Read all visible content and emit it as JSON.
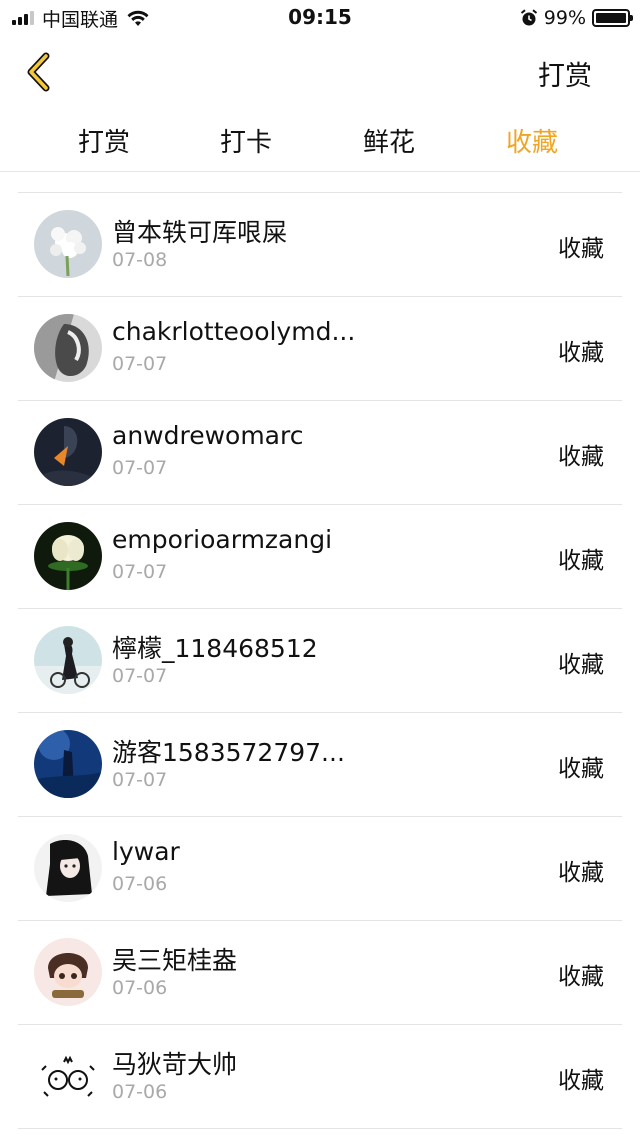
{
  "status_bar": {
    "carrier": "中国联通",
    "time": "09:15",
    "battery": "99%",
    "battery_level": 0.99,
    "icons": [
      "signal-icon",
      "wifi-icon",
      "alarm-icon",
      "battery-icon"
    ]
  },
  "nav": {
    "back_icon": "chevron-left-icon",
    "action_label": "打赏"
  },
  "tabs": [
    {
      "label": "打赏",
      "active": false
    },
    {
      "label": "打卡",
      "active": false
    },
    {
      "label": "鲜花",
      "active": false
    },
    {
      "label": "收藏",
      "active": true
    }
  ],
  "accent_color": "#f0a624",
  "list": [
    {
      "name": "曾本轶可厍哏屎",
      "date": "07-08",
      "action": "收藏"
    },
    {
      "name": "chakrlotteoolymd...",
      "date": "07-07",
      "action": "收藏"
    },
    {
      "name": "anwdrewomarc",
      "date": "07-07",
      "action": "收藏"
    },
    {
      "name": "emporioarmzangi",
      "date": "07-07",
      "action": "收藏"
    },
    {
      "name": "檸檬_118468512",
      "date": "07-07",
      "action": "收藏"
    },
    {
      "name": "游客1583572797...",
      "date": "07-07",
      "action": "收藏"
    },
    {
      "name": "lywar",
      "date": "07-06",
      "action": "收藏"
    },
    {
      "name": "吴三矩桂盎",
      "date": "07-06",
      "action": "收藏"
    },
    {
      "name": "马狄苛大帅",
      "date": "07-06",
      "action": "收藏"
    }
  ]
}
